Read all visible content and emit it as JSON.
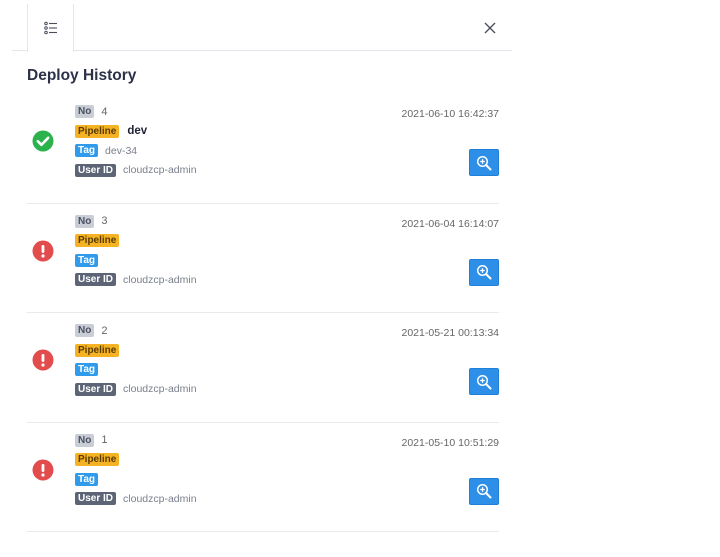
{
  "panel": {
    "title": "Deploy History",
    "tab_icon": "list-icon",
    "close_icon": "close-icon"
  },
  "labels": {
    "no": "No",
    "pipeline": "Pipeline",
    "tag": "Tag",
    "user_id": "User ID"
  },
  "colors": {
    "success": "#2bb24c",
    "error": "#e24c4c",
    "pipeline_badge": "#f5b324",
    "tag_badge": "#2f9bea",
    "user_badge": "#5d6475",
    "no_badge": "#c9cdd6",
    "zoom_button": "#2d8fe8"
  },
  "deploys": [
    {
      "status": "success",
      "status_icon": "check-circle-icon",
      "no": "4",
      "pipeline": "dev",
      "tag": "dev-34",
      "user_id": "cloudzcp-admin",
      "timestamp": "2021-06-10 16:42:37"
    },
    {
      "status": "error",
      "status_icon": "exclamation-circle-icon",
      "no": "3",
      "pipeline": "",
      "tag": "",
      "user_id": "cloudzcp-admin",
      "timestamp": "2021-06-04 16:14:07"
    },
    {
      "status": "error",
      "status_icon": "exclamation-circle-icon",
      "no": "2",
      "pipeline": "",
      "tag": "",
      "user_id": "cloudzcp-admin",
      "timestamp": "2021-05-21 00:13:34"
    },
    {
      "status": "error",
      "status_icon": "exclamation-circle-icon",
      "no": "1",
      "pipeline": "",
      "tag": "",
      "user_id": "cloudzcp-admin",
      "timestamp": "2021-05-10 10:51:29"
    }
  ]
}
